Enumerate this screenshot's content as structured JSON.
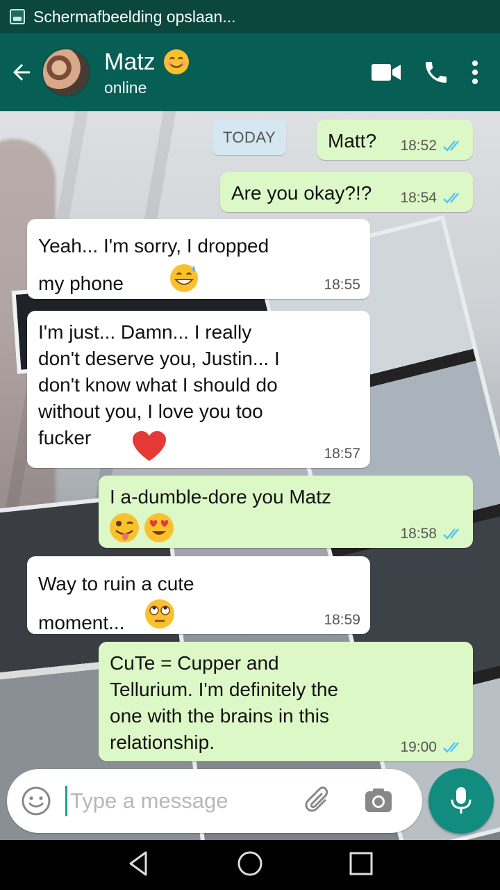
{
  "status_bar": {
    "icon": "screenshot-icon",
    "text": "Schermafbeelding opslaan..."
  },
  "header": {
    "back_icon": "arrow-left-icon",
    "contact_name": "Matz",
    "name_emoji": "smiling-face-icon",
    "status": "online",
    "actions": [
      "video-call-icon",
      "voice-call-icon",
      "more-options-icon"
    ]
  },
  "date_chip": "TODAY",
  "messages": [
    {
      "dir": "out",
      "text": "Matt?",
      "time": "18:52",
      "read": true
    },
    {
      "dir": "out",
      "text": "Are you okay?!?",
      "time": "18:54",
      "read": true
    },
    {
      "dir": "in",
      "text": "Yeah... I'm sorry, I dropped\nmy phone",
      "emoji": [
        "grinning-sweat-emoji"
      ],
      "time": "18:55"
    },
    {
      "dir": "in",
      "text": "I'm just... Damn... I really\ndon't deserve you, Justin... I\ndon't know what I should do\nwithout you, I love you too\nfucker",
      "emoji": [
        "red-heart-emoji"
      ],
      "time": "18:57"
    },
    {
      "dir": "out",
      "text": "I a-dumble-dore you Matz",
      "emoji": [
        "winking-tongue-emoji",
        "heart-eyes-emoji"
      ],
      "time": "18:58",
      "read": true
    },
    {
      "dir": "in",
      "text": "Way to ruin a cute\nmoment...",
      "emoji": [
        "eye-roll-emoji"
      ],
      "time": "18:59"
    },
    {
      "dir": "out",
      "text": "CuTe = Cupper and\nTellurium. I'm definitely the\none with the brains in this\nrelationship.",
      "time": "19:00",
      "read": true
    }
  ],
  "input": {
    "placeholder": "Type a message",
    "icons": [
      "emoji-icon",
      "attach-icon",
      "camera-icon",
      "mic-icon"
    ]
  },
  "colors": {
    "header": "#075e54",
    "status_bar": "#0b473c",
    "outgoing_bubble": "#dcf8c6",
    "incoming_bubble": "#ffffff",
    "read_ticks": "#4fc3f7",
    "mic_button": "#128c7e"
  },
  "nav": [
    "back-icon",
    "home-icon",
    "recents-icon"
  ]
}
